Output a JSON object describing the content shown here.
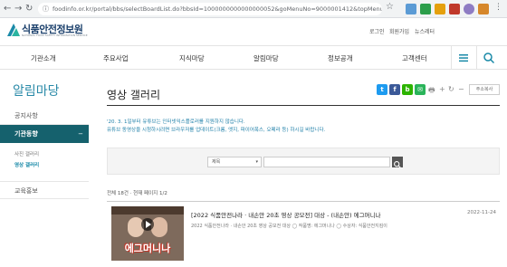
{
  "browser": {
    "back": "←",
    "forward": "→",
    "reload": "↻",
    "url": "foodinfo.or.kr/portal/bbs/selectBoardList.do?bbsId=1000000000000000052&goMenuNo=9000001412&topMenuNo=900000..."
  },
  "header": {
    "logo_name": "식품안전정보원",
    "logo_sub": "NATIONAL FOOD SAFETY INFORMATION SERVICE",
    "login": "로그인",
    "join": "회원가입",
    "newsletter": "뉴스레터",
    "sns": [
      {
        "label": "▶",
        "color": "#e8412c"
      },
      {
        "label": "f",
        "color": "#3b5998"
      },
      {
        "label": "b",
        "color": "#2db400"
      },
      {
        "label": "O",
        "color": "#d6286c"
      }
    ]
  },
  "gnb": {
    "items": [
      "기관소개",
      "주요사업",
      "지식마당",
      "알림마당",
      "정보공개",
      "고객센터"
    ]
  },
  "lnb": {
    "title": "알림마당",
    "items": [
      "공지사항",
      "기관동향",
      "교육홍보"
    ],
    "active_marker": "−",
    "sub_items": [
      "사진 갤러리",
      "영상 갤러리"
    ]
  },
  "content": {
    "title": "영상 갤러리",
    "addr_copy": "주소복사",
    "tools": [
      "🖶",
      "+",
      "↻",
      "−"
    ],
    "notice_lines": [
      "'20. 3. 1일부터 유튜브는 인터넷익스플로러를 지원하지 않습니다.",
      "유튜브 동영상을 시청하시려면 브라우저를 업데이트(크롬, 엣지, 파이어폭스, 오페라 등) 하시길 바랍니다."
    ],
    "search_select": "제목",
    "count_text": "전체 18건 · 현재 페이지 1/2",
    "post": {
      "title": "[2022 식품안전나라 · 내손안 20초 영상 공모전] 대상 - (내손안) 에그머니나",
      "date": "2022-11-24",
      "desc": "2022 식품안전나라 · 내손안 20초 영상 공모전 대상 ◯ 작품명: 에그머니나 ◯ 수상자: 식품안전지킴이",
      "thumb_caption": "에그머니나"
    }
  }
}
